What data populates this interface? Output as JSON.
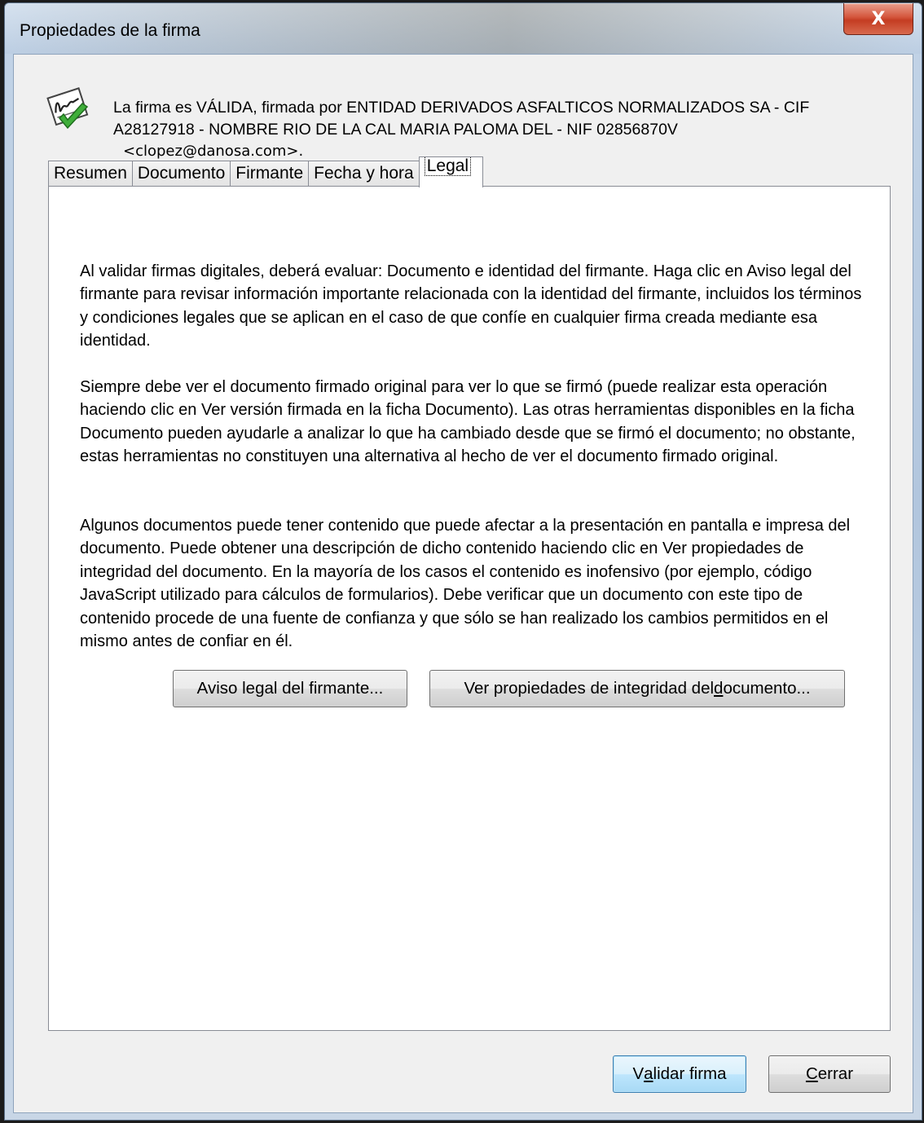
{
  "window": {
    "title": "Propiedades de la firma",
    "close_glyph": "X"
  },
  "status": {
    "icon": "signature-valid-check-icon",
    "text": "La firma es VÁLIDA, firmada por ENTIDAD DERIVADOS ASFALTICOS NORMALIZADOS SA - CIF A28127918 - NOMBRE RIO DE LA CAL MARIA PALOMA DEL - NIF 02856870V",
    "email": "<clopez@danosa.com>."
  },
  "tabs": [
    {
      "label": "Resumen"
    },
    {
      "label": "Documento"
    },
    {
      "label": "Firmante"
    },
    {
      "label": "Fecha y hora"
    },
    {
      "label": "Legal",
      "active": true
    }
  ],
  "legal": {
    "paragraph_1": "Al validar firmas digitales, deberá evaluar: Documento e identidad del firmante. Haga clic en Aviso legal del firmante para revisar información importante relacionada con la identidad del firmante, incluidos los términos y condiciones legales que se aplican en el caso de que confíe en cualquier firma creada mediante esa identidad.",
    "paragraph_2": "Siempre debe ver el documento firmado original para ver lo que se firmó (puede realizar esta operación haciendo clic en Ver versión firmada en la ficha Documento). Las otras herramientas disponibles en la ficha Documento pueden ayudarle a analizar lo que ha cambiado desde que se firmó el documento; no obstante, estas herramientas no constituyen una alternativa al hecho de ver el documento firmado original.",
    "paragraph_3": "Algunos documentos puede tener contenido que puede afectar a la presentación en pantalla e impresa del documento. Puede obtener una descripción de dicho contenido haciendo clic en Ver propiedades de integridad del documento. En la mayoría de los casos el contenido es inofensivo (por ejemplo, código JavaScript utilizado para cálculos de formularios). Debe verificar que un documento con este tipo de contenido procede de una fuente de confianza y que sólo se han realizado los cambios permitidos en el mismo antes de confiar en él.",
    "signer_notice_button": "Aviso legal del firmante...",
    "integrity_button_prefix": "Ver propiedades de integridad del ",
    "integrity_button_access": "d",
    "integrity_button_suffix": "ocumento..."
  },
  "footer": {
    "validate_prefix": "V",
    "validate_access": "a",
    "validate_suffix": "lidar firma",
    "close_access": "C",
    "close_suffix": "errar"
  }
}
